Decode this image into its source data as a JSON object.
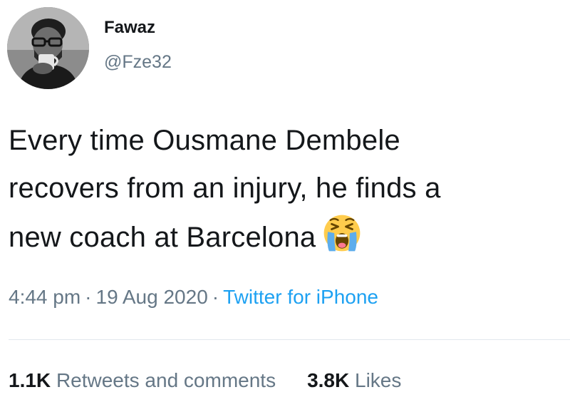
{
  "user": {
    "display_name": "Fawaz",
    "handle": "@Fze32",
    "avatar_icon": "profile-photo"
  },
  "tweet": {
    "lines": [
      "Every time Ousmane Dembele",
      "recovers from an injury, he finds a",
      "new coach at Barcelona"
    ],
    "emoji": "loudly-crying-face-icon"
  },
  "meta": {
    "time": "4:44 pm",
    "separator": "·",
    "date": "19 Aug 2020",
    "source": "Twitter for iPhone"
  },
  "stats": {
    "retweets_count": "1.1K",
    "retweets_label": "Retweets and comments",
    "likes_count": "3.8K",
    "likes_label": "Likes"
  },
  "colors": {
    "text": "#14171a",
    "secondary": "#657786",
    "link": "#1da1f2",
    "divider": "#e1e8ed"
  }
}
